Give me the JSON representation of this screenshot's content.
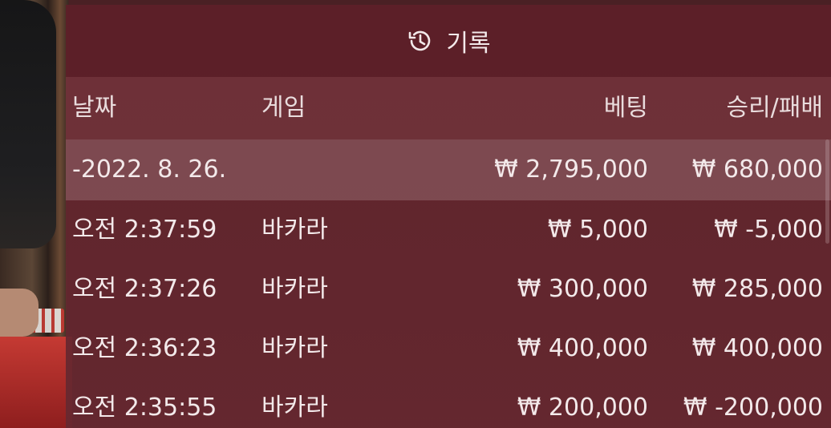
{
  "header": {
    "title": "기록",
    "icon": "history-icon"
  },
  "columns": {
    "date": "날짜",
    "game": "게임",
    "bet": "베팅",
    "winloss": "승리/패배"
  },
  "summary": {
    "date": "-2022. 8. 26.",
    "bet": "₩ 2,795,000",
    "winloss": "₩ 680,000"
  },
  "rows": [
    {
      "time": "오전 2:37:59",
      "game": "바카라",
      "bet": "₩ 5,000",
      "winloss": "₩ -5,000"
    },
    {
      "time": "오전 2:37:26",
      "game": "바카라",
      "bet": "₩ 300,000",
      "winloss": "₩ 285,000"
    },
    {
      "time": "오전 2:36:23",
      "game": "바카라",
      "bet": "₩ 400,000",
      "winloss": "₩ 400,000"
    },
    {
      "time": "오전 2:35:55",
      "game": "바카라",
      "bet": "₩ 200,000",
      "winloss": "₩ -200,000"
    }
  ],
  "colors": {
    "panel": "#60242c",
    "header": "#5c2028",
    "date_row": "#96686e",
    "text": "#f3e9ea"
  }
}
